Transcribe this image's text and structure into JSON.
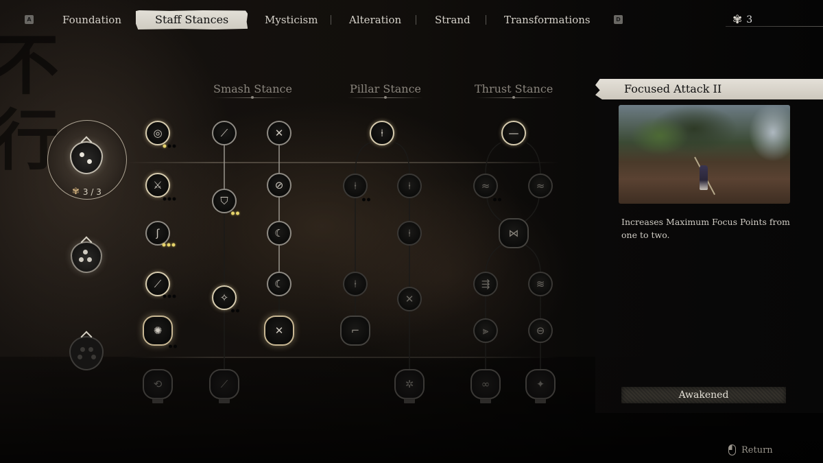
{
  "nav": {
    "prev_key": "A",
    "next_key": "D",
    "tabs": [
      {
        "label": "Foundation",
        "active": false
      },
      {
        "label": "Staff Stances",
        "active": true
      },
      {
        "label": "Mysticism",
        "active": false
      },
      {
        "label": "Alteration",
        "active": false
      },
      {
        "label": "Strand",
        "active": false
      },
      {
        "label": "Transformations",
        "active": false
      }
    ],
    "spark_points": "3",
    "spark_icon": "spark-swirl-icon"
  },
  "stance_selector": {
    "active_stance_points": "3 / 3",
    "stances": [
      {
        "name": "stance-level-1",
        "pips": 2,
        "state": "selected"
      },
      {
        "name": "stance-level-2",
        "pips": 3,
        "state": "available"
      },
      {
        "name": "stance-level-3",
        "pips": 4,
        "state": "locked"
      }
    ]
  },
  "columns": {
    "smash": "Smash Stance",
    "pillar": "Pillar Stance",
    "thrust": "Thrust Stance"
  },
  "nodes": {
    "base": [
      {
        "icon": "focus-flame-icon",
        "glyph": "◎",
        "state": "gold",
        "pips": [
          true,
          false,
          false
        ]
      },
      {
        "icon": "staff-spin-icon",
        "glyph": "⚔",
        "state": "gold",
        "pips": [
          false,
          false,
          false
        ]
      },
      {
        "icon": "hook-swing-icon",
        "glyph": "ʃ",
        "state": "normal",
        "pips": [
          true,
          true,
          true
        ]
      },
      {
        "icon": "staff-flurry-icon",
        "glyph": "⟋",
        "state": "gold",
        "pips": [
          false,
          false,
          false
        ]
      },
      {
        "icon": "whirl-staff-icon",
        "glyph": "✺",
        "state": "ornate-gold",
        "pips": [
          false,
          false
        ]
      },
      {
        "icon": "spin-strike-icon",
        "glyph": "⟲",
        "state": "locked",
        "pips": []
      }
    ],
    "smash_a": [
      {
        "icon": "smash-charge-icon",
        "glyph": "⟋",
        "state": "normal"
      },
      {
        "icon": "smash-shield-icon",
        "glyph": "⛉",
        "state": "normal",
        "pips": [
          true,
          true
        ]
      },
      {
        "icon": "smash-sparkle-icon",
        "glyph": "✧",
        "state": "gold",
        "pips": [
          false,
          false
        ]
      },
      {
        "icon": "smash-fire-icon",
        "glyph": "⟋",
        "state": "locked"
      }
    ],
    "smash_b": [
      {
        "icon": "crossed-staff-icon",
        "glyph": "✕",
        "state": "normal"
      },
      {
        "icon": "slash-circle-icon",
        "glyph": "⊘",
        "state": "normal"
      },
      {
        "icon": "crescent-icon",
        "glyph": "☾",
        "state": "normal"
      },
      {
        "icon": "crescent-fire-icon",
        "glyph": "☾",
        "state": "normal"
      },
      {
        "icon": "crossed-fire-icon",
        "glyph": "✕",
        "state": "ornate-gold"
      }
    ],
    "pillar": [
      {
        "icon": "pillar-root-icon",
        "glyph": "⍿",
        "state": "gold"
      },
      {
        "icon": "pillar-grass-icon",
        "glyph": "⍿",
        "state": "dim",
        "pips": [
          false,
          false
        ]
      },
      {
        "icon": "pillar-swirl-icon",
        "glyph": "⍿",
        "state": "dim"
      },
      {
        "icon": "pillar-whirl-icon",
        "glyph": "⍿",
        "state": "dim"
      },
      {
        "icon": "pillar-lean-icon",
        "glyph": "⍿",
        "state": "dim"
      },
      {
        "icon": "pillar-cross-icon",
        "glyph": "✕",
        "state": "dim"
      },
      {
        "icon": "pillar-hook-icon",
        "glyph": "⌐",
        "state": "ornate-dim"
      },
      {
        "icon": "pillar-burst-icon",
        "glyph": "✲",
        "state": "locked"
      }
    ],
    "thrust": [
      {
        "icon": "thrust-line-icon",
        "glyph": "—",
        "state": "gold"
      },
      {
        "icon": "thrust-wave-left-icon",
        "glyph": "≈",
        "state": "dim",
        "pips": [
          false,
          false
        ]
      },
      {
        "icon": "thrust-wave-right-icon",
        "glyph": "≈",
        "state": "dim"
      },
      {
        "icon": "thrust-cross-icon",
        "glyph": "⋈",
        "state": "ornate-dim"
      },
      {
        "icon": "thrust-multi-icon",
        "glyph": "⇶",
        "state": "dim"
      },
      {
        "icon": "thrust-flow-icon",
        "glyph": "≋",
        "state": "dim"
      },
      {
        "icon": "thrust-feather-icon",
        "glyph": "⫸",
        "state": "dim"
      },
      {
        "icon": "thrust-ring-icon",
        "glyph": "⊖",
        "state": "dim"
      },
      {
        "icon": "thrust-spiral-icon",
        "glyph": "∞",
        "state": "locked"
      },
      {
        "icon": "thrust-star-icon",
        "glyph": "✦",
        "state": "locked"
      }
    ]
  },
  "info": {
    "title": "Focused Attack II",
    "description": "Increases Maximum Focus Points from one to two.",
    "status": "Awakened",
    "preview_alt": "skill-preview-image"
  },
  "footer": {
    "return_label": "Return"
  },
  "background": {
    "calligraphy": "不行"
  }
}
